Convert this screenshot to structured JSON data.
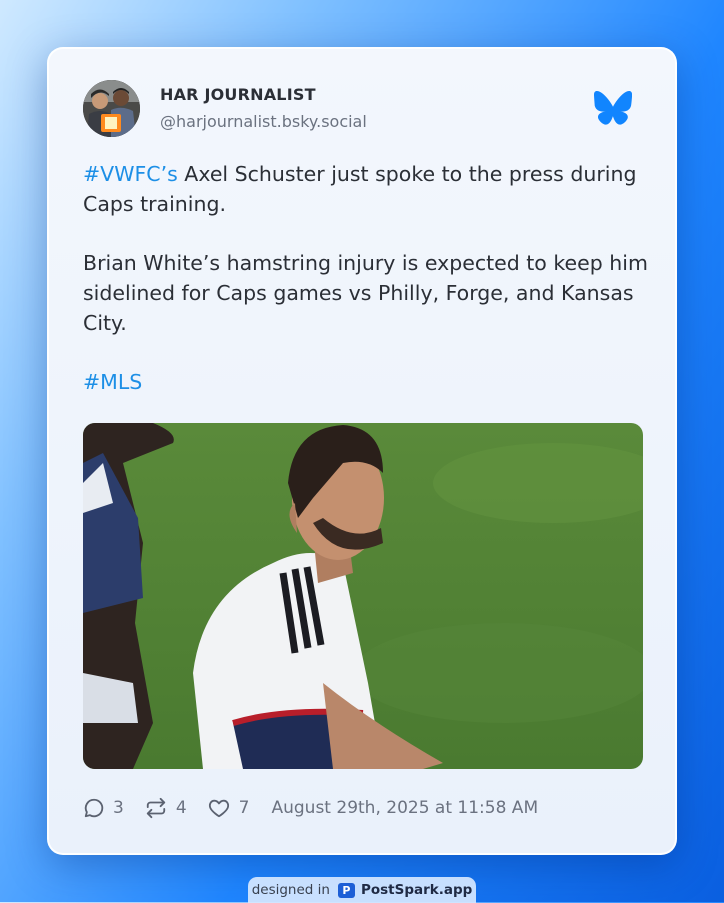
{
  "post": {
    "author_name": "HAR JOURNALIST",
    "author_handle": "@harjournalist.bsky.social",
    "line1_tag": "#VWFC’s",
    "line1_text": " Axel Schuster just spoke to the press during Caps training.",
    "paragraph2": "Brian White’s hamstring injury is expected to keep him sidelined for Caps games vs Philly, Forge, and Kansas City.",
    "hashtag": "#MLS",
    "media_icon": "soccer-player-photo",
    "brand_icon": "bluesky-butterfly-icon"
  },
  "stats": {
    "replies": "3",
    "reposts": "4",
    "likes": "7",
    "timestamp": "August 29th, 2025 at 11:58 AM"
  },
  "badge": {
    "prefix": "designed in",
    "logo_letter": "P",
    "brand": "PostSpark.app"
  },
  "colors": {
    "accent": "#1d8fe6",
    "bluesky": "#1185fe",
    "text": "#2b2f36",
    "muted": "#6b7280"
  }
}
